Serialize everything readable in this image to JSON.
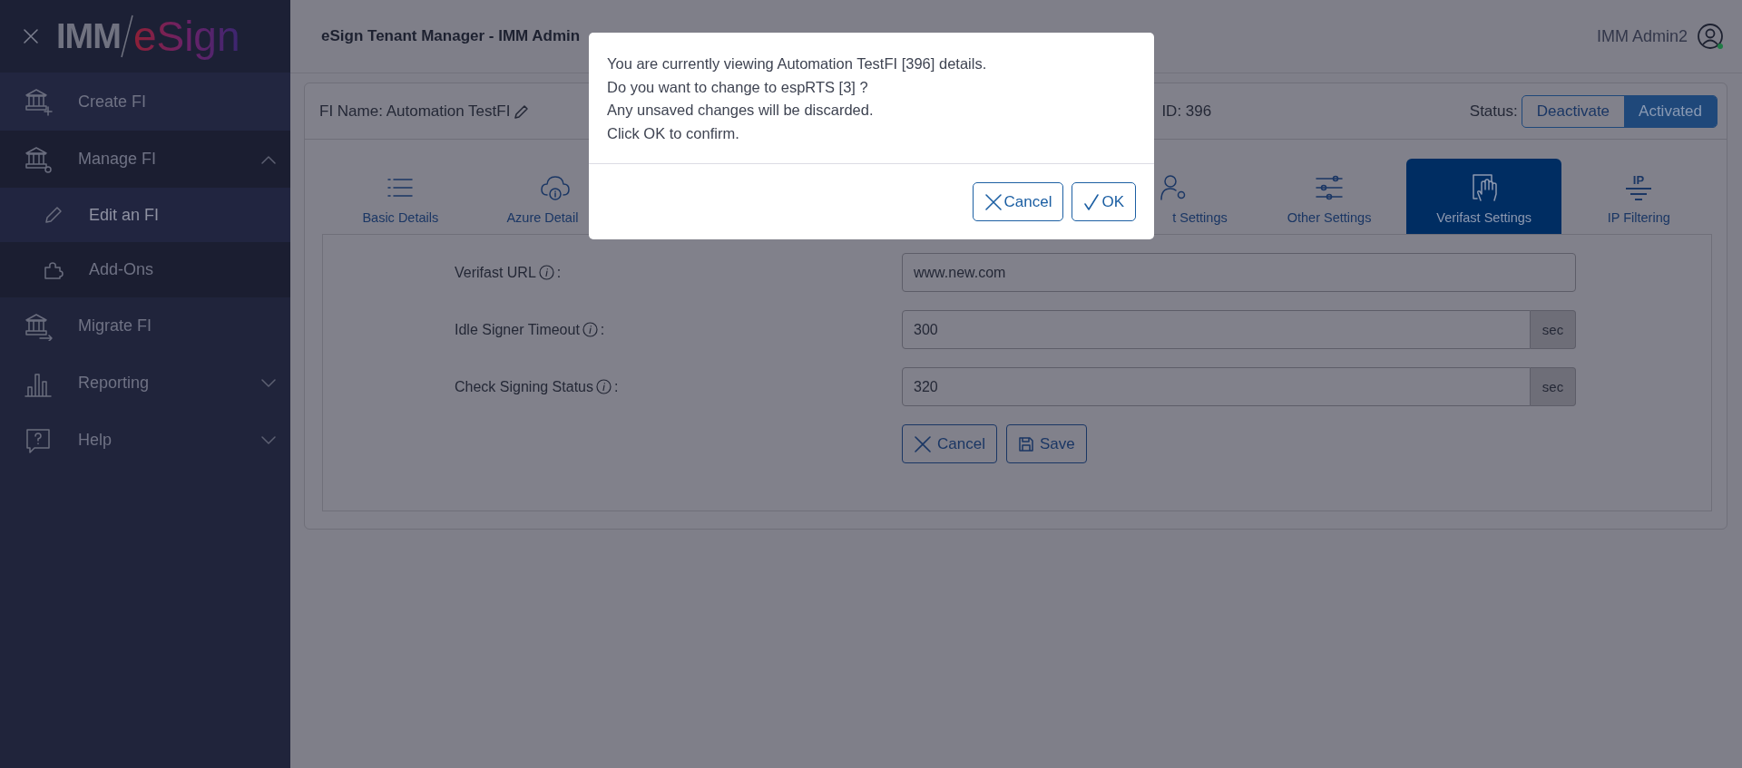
{
  "sidebar": {
    "logo": {
      "prefix": "IMM",
      "name": "eSign"
    },
    "items": [
      {
        "label": "Create FI",
        "selected": false,
        "expanded": false
      },
      {
        "label": "Manage FI",
        "selected": false,
        "expanded": true,
        "children": [
          {
            "label": "Edit an FI",
            "selected": true
          },
          {
            "label": "Add-Ons",
            "selected": false
          }
        ]
      },
      {
        "label": "Migrate FI",
        "selected": false
      },
      {
        "label": "Reporting",
        "selected": false,
        "expanded": false
      },
      {
        "label": "Help",
        "selected": false,
        "expanded": false
      }
    ]
  },
  "header": {
    "title": "eSign Tenant Manager - IMM Admin",
    "user": "IMM Admin2"
  },
  "fi": {
    "name_label": "FI Name: Automation TestFI",
    "id_label": "ID: 396",
    "status_label": "Status:",
    "status_options": [
      {
        "label": "Deactivate",
        "selected": false
      },
      {
        "label": "Activated",
        "selected": true
      }
    ]
  },
  "tabs": [
    {
      "label": "Basic Details",
      "selected": false
    },
    {
      "label": "Azure Detail",
      "selected": false
    },
    {
      "label": "t Settings",
      "selected": false
    },
    {
      "label": "Other Settings",
      "selected": false
    },
    {
      "label": "Verifast Settings",
      "selected": true
    },
    {
      "label": "IP Filtering",
      "selected": false,
      "icon_text": "IP"
    }
  ],
  "form": {
    "fields": [
      {
        "label": "Verifast URL",
        "colon": ":",
        "value": "www.new.com"
      },
      {
        "label": "Idle Signer Timeout",
        "colon": ":",
        "value": "300",
        "unit": "sec"
      },
      {
        "label": "Check Signing Status",
        "colon": ":",
        "value": "320",
        "unit": "sec"
      }
    ],
    "buttons": [
      "Cancel",
      "Save"
    ]
  },
  "dialog": {
    "lines": [
      "You are currently viewing Automation TestFI [396] details.",
      "Do you want to change to espRTS [3] ?",
      "Any unsaved changes will be discarded.",
      "Click OK to confirm."
    ],
    "buttons": [
      "Cancel",
      "OK"
    ]
  }
}
